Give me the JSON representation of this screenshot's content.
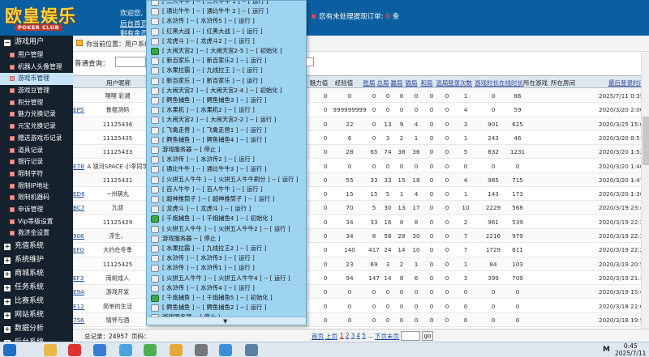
{
  "header": {
    "logo_text": "欧皇娱乐",
    "logo_sub": "POKER CLUB",
    "welcome": "欢迎您,",
    "nav_home": "后台首页",
    "nav_gold": "剩有金币:",
    "warn_text": "您有未处理提现订单:",
    "warn_count": "0",
    "warn_unit": "条"
  },
  "sidebar": {
    "groups_top": [
      {
        "label": "游戏用户",
        "icon": "minus-icon"
      }
    ],
    "items": [
      {
        "label": "用户管理",
        "active": false
      },
      {
        "label": "机器人头像管理",
        "active": false
      },
      {
        "label": "游戏币管理",
        "active": true
      },
      {
        "label": "游戏豆管理",
        "active": false
      },
      {
        "label": "积分管理",
        "active": false
      },
      {
        "label": "魅力兑换记录",
        "active": false
      },
      {
        "label": "元宝兑换记录",
        "active": false
      },
      {
        "label": "赠送游戏币记录",
        "active": false
      },
      {
        "label": "道具记录",
        "active": false
      },
      {
        "label": "银行记录",
        "active": false
      },
      {
        "label": "限制字符",
        "active": false
      },
      {
        "label": "限制IP地址",
        "active": false
      },
      {
        "label": "限制机器码",
        "active": false
      },
      {
        "label": "申诉管理",
        "active": false
      },
      {
        "label": "Vip等级设置",
        "active": false
      },
      {
        "label": "救济金设置",
        "active": false
      }
    ],
    "groups_bottom": [
      {
        "label": "充值系统"
      },
      {
        "label": "系统维护"
      },
      {
        "label": "商城系统"
      },
      {
        "label": "任务系统"
      },
      {
        "label": "比赛系统"
      },
      {
        "label": "网站系统"
      },
      {
        "label": "数据分析"
      },
      {
        "label": "后台系统"
      }
    ]
  },
  "breadcrumb": "你当前位置：用户系统",
  "search": {
    "label": "普通查询："
  },
  "table": {
    "headers": [
      {
        "label": "用户昵称",
        "link": false
      },
      {
        "label": "力",
        "link": false
      },
      {
        "label": "魅力值",
        "link": false
      },
      {
        "label": "经验值",
        "link": false
      },
      {
        "label": "胜局",
        "link": true
      },
      {
        "label": "总局",
        "link": true
      },
      {
        "label": "赢局",
        "link": true
      },
      {
        "label": "输局",
        "link": true
      },
      {
        "label": "和局",
        "link": true
      },
      {
        "label": "逃局",
        "link": true
      },
      {
        "label": "登录次数",
        "link": true
      },
      {
        "label": "游戏时长",
        "link": true
      },
      {
        "label": "在线时长",
        "link": true
      },
      {
        "label": "所在游戏",
        "link": false
      },
      {
        "label": "所在房间",
        "link": false
      },
      {
        "label": "最后登录时间",
        "link": true
      }
    ],
    "rows": [
      {
        "acct": "",
        "nick": "嘿嘿 彩溯",
        "f1": "0",
        "f2": "0",
        "f3": "0",
        "f4": "0",
        "f5": "0",
        "f6": "0",
        "f7": "0",
        "f8": "0",
        "f9": "1",
        "f10": "0",
        "f11": "86",
        "last": "2025/7/11 0:35"
      },
      {
        "acct": "EP58",
        "nick": "鲁棍测码",
        "f1": "0",
        "f2": "999999999",
        "f3": "0",
        "f4": "0",
        "f5": "0",
        "f6": "0",
        "f7": "0",
        "f8": "0",
        "f9": "4",
        "f10": "0",
        "f11": "59",
        "last": "2020/3/20 2:00"
      },
      {
        "acct": "",
        "nick": "11125436",
        "f1": "0",
        "f2": "22",
        "f3": "0",
        "f4": "13",
        "f5": "9",
        "f6": "4",
        "f7": "0",
        "f8": "0",
        "f9": "3",
        "f10": "901",
        "f11": "625",
        "last": "2020/3/25 15:05"
      },
      {
        "acct": "",
        "nick": "11125435",
        "f1": "0",
        "f2": "6",
        "f3": "0",
        "f4": "3",
        "f5": "2",
        "f6": "1",
        "f7": "0",
        "f8": "0",
        "f9": "1",
        "f10": "243",
        "f11": "46",
        "last": "2020/3/20 8:51"
      },
      {
        "acct": "",
        "nick": "11125433",
        "f1": "0",
        "f2": "28",
        "f3": "65",
        "f4": "74",
        "f5": "38",
        "f6": "36",
        "f7": "0",
        "f8": "0",
        "f9": "5",
        "f10": "832",
        "f11": "1231",
        "last": "2020/3/20 1:52"
      },
      {
        "acct": "E7B1",
        "nick": "A 银河SPACE 小李同学",
        "f1": "0",
        "f2": "0",
        "f3": "0",
        "f4": "0",
        "f5": "0",
        "f6": "0",
        "f7": "0",
        "f8": "0",
        "f9": "0",
        "f10": "0",
        "f11": "0",
        "last": "2020/3/20 1:40"
      },
      {
        "acct": "",
        "nick": "11125431",
        "f1": "0",
        "f2": "55",
        "f3": "33",
        "f4": "33",
        "f5": "15",
        "f6": "18",
        "f7": "0",
        "f8": "0",
        "f9": "4",
        "f10": "985",
        "f11": "715",
        "last": "2020/3/20 1:47"
      },
      {
        "acct": "ED6D",
        "nick": "~州萌丸",
        "f1": "0",
        "f2": "15",
        "f3": "15",
        "f4": "5",
        "f5": "1",
        "f6": "4",
        "f7": "0",
        "f8": "0",
        "f9": "1",
        "f10": "143",
        "f11": "173",
        "last": "2020/3/20 1:36"
      },
      {
        "acct": "BC75",
        "nick": "九叔",
        "f1": "0",
        "f2": "70",
        "f3": "5",
        "f4": "30",
        "f5": "13",
        "f6": "17",
        "f7": "0",
        "f8": "0",
        "f9": "10",
        "f10": "2229",
        "f11": "568",
        "last": "2020/3/19 23:44"
      },
      {
        "acct": "",
        "nick": "11125429",
        "f1": "0",
        "f2": "34",
        "f3": "33",
        "f4": "16",
        "f5": "8",
        "f6": "8",
        "f7": "0",
        "f8": "0",
        "f9": "2",
        "f10": "961",
        "f11": "539",
        "last": "2020/3/19 22:24"
      },
      {
        "acct": "9068",
        "nick": "浮生、",
        "f1": "0",
        "f2": "34",
        "f3": "8",
        "f4": "58",
        "f5": "28",
        "f6": "30",
        "f7": "0",
        "f8": "0",
        "f9": "7",
        "f10": "2216",
        "f11": "979",
        "last": "2020/3/19 22:31"
      },
      {
        "acct": "EF09",
        "nick": "大约在冬季",
        "f1": "0",
        "f2": "140",
        "f3": "417",
        "f4": "24",
        "f5": "14",
        "f6": "10",
        "f7": "0",
        "f8": "0",
        "f9": "7",
        "f10": "1729",
        "f11": "611",
        "last": "2020/3/19 22:25"
      },
      {
        "acct": "",
        "nick": "11125425",
        "f1": "0",
        "f2": "23",
        "f3": "69",
        "f4": "3",
        "f5": "2",
        "f6": "1",
        "f7": "0",
        "f8": "0",
        "f9": "1",
        "f10": "84",
        "f11": "103",
        "last": "2020/3/19 20:50"
      },
      {
        "acct": "EF3E",
        "nick": "南树成人",
        "f1": "0",
        "f2": "94",
        "f3": "147",
        "f4": "14",
        "f5": "8",
        "f6": "6",
        "f7": "0",
        "f8": "0",
        "f9": "3",
        "f10": "399",
        "f11": "709",
        "last": "2020/3/19 21:11"
      },
      {
        "acct": "E9AB",
        "nick": "游戏开发",
        "f1": "0",
        "f2": "0",
        "f3": "0",
        "f4": "0",
        "f5": "0",
        "f6": "0",
        "f7": "0",
        "f8": "0",
        "f9": "0",
        "f10": "0",
        "f11": "0",
        "last": "2020/3/19 15:40"
      },
      {
        "acct": "E127",
        "nick": "简单的生活",
        "f1": "0",
        "f2": "0",
        "f3": "0",
        "f4": "0",
        "f5": "0",
        "f6": "0",
        "f7": "0",
        "f8": "0",
        "f9": "0",
        "f10": "0",
        "f11": "0",
        "last": "2020/3/18 21:01"
      },
      {
        "acct": "7565",
        "nick": "情怀与酒",
        "f1": "0",
        "f2": "0",
        "f3": "0",
        "f4": "0",
        "f5": "0",
        "f6": "0",
        "f7": "0",
        "f8": "0",
        "f9": "0",
        "f10": "0",
        "f11": "0",
        "last": "2020/3/18 19:58"
      }
    ]
  },
  "footer": {
    "total": "总记录：24957",
    "pages_label": "页码：",
    "first": "首页",
    "prev": "上页",
    "pages": [
      "1",
      "2",
      "3",
      "4",
      "5"
    ],
    "ellipsis": "...",
    "next": "下页",
    "last": "末页",
    "go": "go"
  },
  "dropdown": {
    "items": [
      {
        "label": "[ 二人牛牛 ] -- [ 二人牛牛 1 ] -- [ 运行 ]",
        "icon": "game-icon"
      },
      {
        "label": "[ 通比牛牛 ] -- [ 通比牛牛 2 ] -- [ 运行 ]",
        "icon": "game-icon"
      },
      {
        "label": "[ 水浒传 ] -- [ 水浒传5 ] -- [ 运行 ]",
        "icon": "game-icon"
      },
      {
        "label": "[ 红黑大战 ] -- [ 红黑大战 ] -- [ 运行 ]",
        "icon": "game-icon"
      },
      {
        "label": "[ 龙虎斗 ] -- [ 龙虎斗2 ] -- [ 运行 ]",
        "icon": "game-icon"
      },
      {
        "label": "[ 大闹天宫2 ] -- [ 大闹天宫2-5 ] -- [ 初始化 ]",
        "icon": "green-icon"
      },
      {
        "label": "[ 新百家乐 ] -- [ 新百家乐2 ] -- [ 运行 ]",
        "icon": "game-icon"
      },
      {
        "label": "[ 水果拉霸 ] -- [ 九线拉王 ] -- [ 运行 ]",
        "icon": "game-icon"
      },
      {
        "label": "[ 新百家乐 ] -- [ 新百家乐 ] -- [ 运行 ]",
        "icon": "game-icon"
      },
      {
        "label": "[ 大闹天宫2 ] -- [ 大闹天宫2-4 ] -- [ 初始化 ]",
        "icon": "game-icon"
      },
      {
        "label": "[ 鳄鱼捕鱼 ] -- [ 鳄鱼捕鱼3 ] -- [ 运行 ]",
        "icon": "game-icon"
      },
      {
        "label": "[ 水果机 ] -- [ 水果机2 ] -- [ 运行 ]",
        "icon": "game-icon"
      },
      {
        "label": "[ 大闹天宫2 ] -- [ 大闹天宫2-2 ] -- [ 运行 ]",
        "icon": "game-icon"
      },
      {
        "label": "[ 飞禽走兽 ] -- [ 飞禽走兽1 ] -- [ 运行 ]",
        "icon": "game-icon"
      },
      {
        "label": "[ 鳄鱼捕鱼 ] -- [ 鳄鱼捕鱼4 ] -- [ 运行 ]",
        "icon": "game-icon"
      },
      {
        "label": "游戏服务器 -- [ 停止 ]",
        "icon": "game-icon"
      },
      {
        "label": "[ 水浒传 ] -- [ 水浒传2 ] -- [ 运行 ]",
        "icon": "game-icon"
      },
      {
        "label": "[ 通比牛牛 ] -- [ 通比牛牛3 ] -- [ 运行 ]",
        "icon": "game-icon"
      },
      {
        "label": "[ 火拼五人牛牛 ] -- [ 火拼五人牛牛刷分 ] -- [ 运行 ]",
        "icon": "game-icon"
      },
      {
        "label": "[ 百人牛牛 ] -- [ 百人牛牛 ] -- [ 运行 ]",
        "icon": "game-icon"
      },
      {
        "label": "[ 超神推筒子 ] -- [ 超神推筒子 ] -- [ 运行 ]",
        "icon": "game-icon"
      },
      {
        "label": "[ 龙虎斗 ] -- [ 龙虎斗 ] -- [ 运行 ]",
        "icon": "game-icon"
      },
      {
        "label": "[ 千炮捕鱼 ] -- [ 千炮捕鱼4 ] -- [ 初始化 ]",
        "icon": "green-icon"
      },
      {
        "label": "[ 火拼五人牛牛 ] -- [ 火拼五人牛牛2 ] -- [ 运行 ]",
        "icon": "game-icon"
      },
      {
        "label": "游戏服务器 -- [ 停止 ]",
        "icon": "game-icon"
      },
      {
        "label": "[ 水果拉霸 ] -- [ 九线拉王2 ] -- [ 运行 ]",
        "icon": "game-icon"
      },
      {
        "label": "[ 水浒传 ] -- [ 水浒传3 ] -- [ 运行 ]",
        "icon": "game-icon"
      },
      {
        "label": "[ 水浒传 ] -- [ 水浒传1 ] -- [ 运行 ]",
        "icon": "game-icon"
      },
      {
        "label": "[ 火拼五人牛牛 ] -- [ 火拼五人牛牛4 ] -- [ 运行 ]",
        "icon": "game-icon"
      },
      {
        "label": "[ 水浒传 ] -- [ 水浒传4 ] -- [ 运行 ]",
        "icon": "game-icon"
      },
      {
        "label": "[ 千炮捕鱼 ] -- [ 千炮捕鱼5 ] -- [ 初始化 ]",
        "icon": "green-icon"
      },
      {
        "label": "[ 鳄鱼捕鱼 ] -- [ 鳄鱼捕鱼2 ] -- [ 运行 ]",
        "icon": "game-icon"
      },
      {
        "label": "游戏服务器 -- [ 停止 ]",
        "icon": "game-icon"
      }
    ]
  },
  "taskbar": {
    "time": "0:45",
    "date": "2025/7/11",
    "ime": "M",
    "icons": [
      "start-icon",
      "folder-icon",
      "chrome-icon",
      "tools-icon",
      "app-icon",
      "refresh-icon",
      "key-icon",
      "settings-icon",
      "network-icon",
      "shield-icon"
    ]
  },
  "colors": {
    "topbar": "#0b5fa0",
    "sidebar": "#15212d",
    "dropdown": "#9fd4f1",
    "active_item": "#c7e3f6"
  }
}
